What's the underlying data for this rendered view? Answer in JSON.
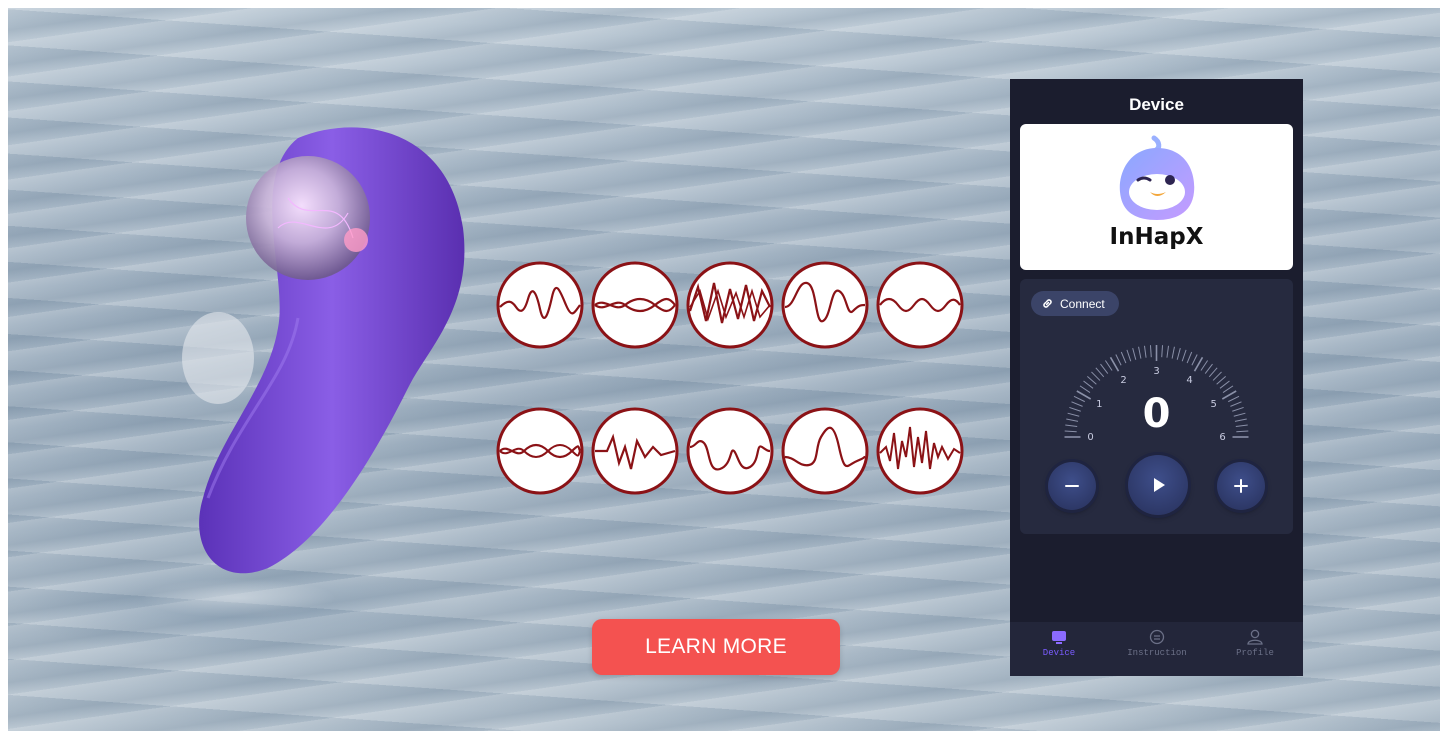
{
  "banner": {
    "learn_more_label": "LEARN MORE",
    "waveform_icons": [
      "waveform-pattern-1-icon",
      "waveform-pattern-2-icon",
      "waveform-pattern-3-icon",
      "waveform-pattern-4-icon",
      "waveform-pattern-5-icon",
      "waveform-pattern-6-icon",
      "waveform-pattern-7-icon",
      "waveform-pattern-8-icon",
      "waveform-pattern-9-icon",
      "waveform-pattern-10-icon"
    ],
    "colors": {
      "button": "#f45250",
      "wave_stroke": "#8b1216",
      "product": "#7b4fd6"
    }
  },
  "app": {
    "title": "Device",
    "brand": {
      "name": "InHapX",
      "logo_icon": "penguin-logo-icon"
    },
    "connect_label": "Connect",
    "dial": {
      "ticks": [
        "0",
        "1",
        "2",
        "3",
        "4",
        "5",
        "6"
      ],
      "value": "0"
    },
    "controls": {
      "minus_icon": "minus-icon",
      "play_icon": "play-icon",
      "plus_icon": "plus-icon"
    },
    "tabs": [
      {
        "label": "Device",
        "icon": "device-icon",
        "active": true
      },
      {
        "label": "Instruction",
        "icon": "instruction-icon",
        "active": false
      },
      {
        "label": "Profile",
        "icon": "profile-icon",
        "active": false
      }
    ],
    "colors": {
      "background": "#1b1d2e",
      "panel": "#262a3f",
      "accent": "#7a5cff"
    }
  }
}
